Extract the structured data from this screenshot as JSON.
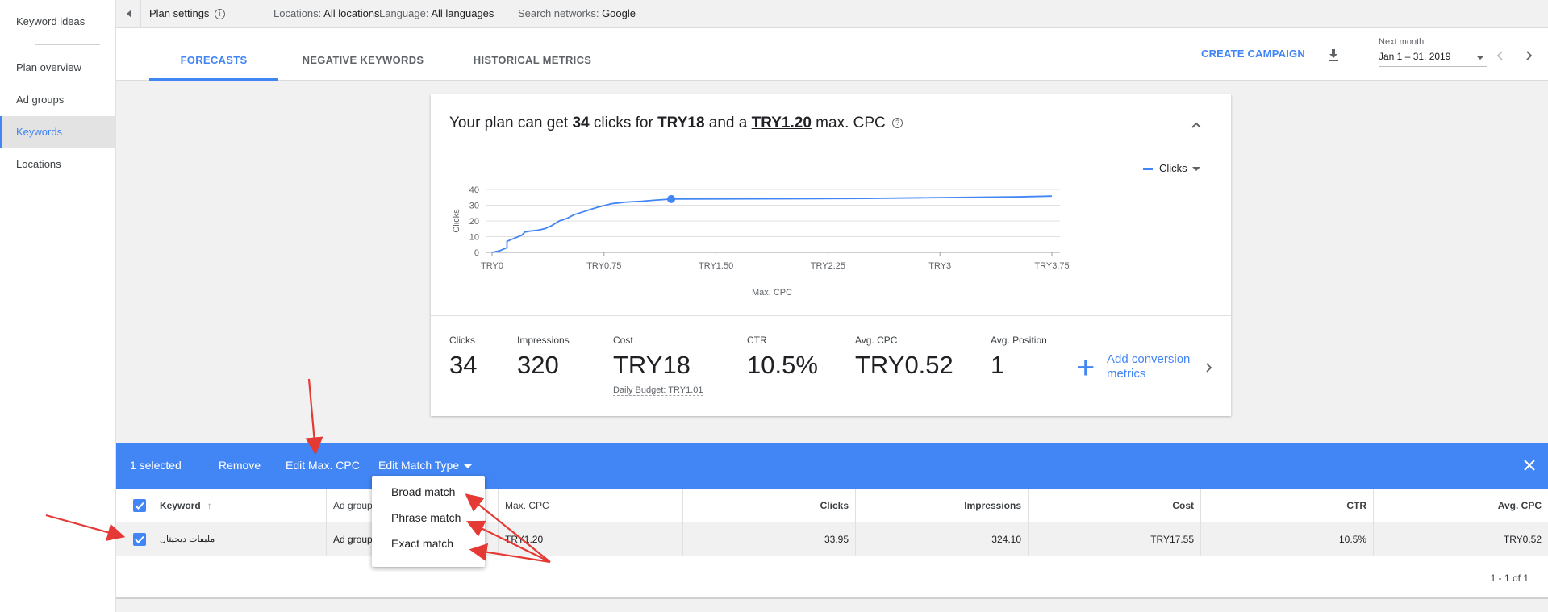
{
  "sidebar": {
    "items": [
      {
        "label": "Keyword ideas"
      },
      {
        "label": "Plan overview"
      },
      {
        "label": "Ad groups"
      },
      {
        "label": "Keywords"
      },
      {
        "label": "Locations"
      }
    ],
    "active": "Keywords"
  },
  "topbar": {
    "plan_settings": "Plan settings",
    "locations_label": "Locations:",
    "locations_value": "All locations",
    "language_label": "Language:",
    "language_value": "All languages",
    "networks_label": "Search networks:",
    "networks_value": "Google"
  },
  "tabs": [
    {
      "label": "FORECASTS"
    },
    {
      "label": "NEGATIVE KEYWORDS"
    },
    {
      "label": "HISTORICAL METRICS"
    }
  ],
  "active_tab": "FORECASTS",
  "header": {
    "create_campaign": "CREATE CAMPAIGN",
    "date_caption": "Next month",
    "date_range": "Jan 1 – 31, 2019"
  },
  "forecast": {
    "headline": {
      "p1": "Your plan can get ",
      "clicks": "34",
      "p2": " clicks for ",
      "cost": "TRY18",
      "p3": " and a ",
      "max_cpc": "TRY1.20",
      "p4": " max. CPC",
      "help": "?"
    },
    "legend": "Clicks",
    "metrics": [
      {
        "label": "Clicks",
        "value": "34"
      },
      {
        "label": "Impressions",
        "value": "320"
      },
      {
        "label": "Cost",
        "value": "TRY18"
      },
      {
        "label": "CTR",
        "value": "10.5%"
      },
      {
        "label": "Avg. CPC",
        "value": "TRY0.52"
      },
      {
        "label": "Avg. Position",
        "value": "1"
      }
    ],
    "daily_budget": "Daily Budget: TRY1.01",
    "add_conversion": {
      "line1": "Add conversion",
      "line2": "metrics"
    }
  },
  "chart_data": {
    "type": "line",
    "xlabel": "Max. CPC",
    "ylabel": "Clicks",
    "xlim": [
      0,
      3.75
    ],
    "ylim": [
      0,
      40
    ],
    "x_ticks": [
      "TRY0",
      "TRY0.75",
      "TRY1.50",
      "TRY2.25",
      "TRY3",
      "TRY3.75"
    ],
    "y_ticks": [
      "0",
      "10",
      "20",
      "30",
      "40"
    ],
    "grid": true,
    "legend_position": "top-right",
    "series": [
      {
        "name": "Clicks",
        "color": "#4285f4",
        "x": [
          0.0,
          0.05,
          0.1,
          0.1,
          0.15,
          0.2,
          0.22,
          0.25,
          0.3,
          0.35,
          0.4,
          0.45,
          0.5,
          0.55,
          0.6,
          0.7,
          0.8,
          0.9,
          1.0,
          1.1,
          1.2,
          1.5,
          2.0,
          2.5,
          3.0,
          3.5,
          3.75
        ],
        "y": [
          0,
          1,
          3,
          7,
          9,
          11,
          13,
          13.5,
          14,
          15,
          17,
          20,
          21.5,
          24,
          25.5,
          28.5,
          31,
          32,
          32.5,
          33.3,
          33.9,
          34,
          34.1,
          34.3,
          34.8,
          35.3,
          35.8
        ]
      }
    ],
    "highlight_point": {
      "x": 1.2,
      "y": 33.9
    }
  },
  "action_bar": {
    "selected": "1 selected",
    "remove": "Remove",
    "edit_max_cpc": "Edit Max. CPC",
    "edit_match_type": "Edit Match Type"
  },
  "match_menu": [
    {
      "label": "Broad match"
    },
    {
      "label": "Phrase match"
    },
    {
      "label": "Exact match"
    }
  ],
  "table": {
    "columns": [
      "Keyword",
      "Ad group",
      "Max. CPC",
      "Clicks",
      "Impressions",
      "Cost",
      "CTR",
      "Avg. CPC"
    ],
    "rows": [
      {
        "keyword": "ملیفات دیجیتال",
        "ad_group": "Ad group",
        "max_cpc": "TRY1.20",
        "clicks": "33.95",
        "impressions": "324.10",
        "cost": "TRY17.55",
        "ctr": "10.5%",
        "avg_cpc": "TRY0.52"
      }
    ],
    "pagination": "1 - 1 of 1"
  },
  "colors": {
    "accent": "#4285f4",
    "annotation": "#e53935"
  }
}
